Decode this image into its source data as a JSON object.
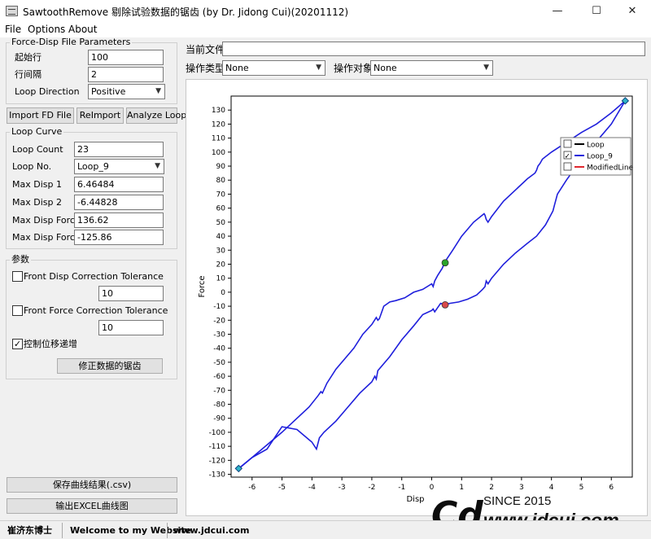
{
  "window": {
    "title": "SawtoothRemove 剔除试验数据的锯齿 (by Dr. Jidong Cui)(20201112)",
    "minimize": "—",
    "maximize": "☐",
    "close": "✕"
  },
  "menu": {
    "file": "File",
    "options": "Options",
    "about": "About"
  },
  "fd_params": {
    "title": "Force-Disp File Parameters",
    "start_row_label": "起始行",
    "start_row_value": "100",
    "row_interval_label": "行间隔",
    "row_interval_value": "2",
    "loop_direction_label": "Loop Direction",
    "loop_direction_value": "Positive"
  },
  "buttons": {
    "import": "Import FD File",
    "reimport": "ReImport",
    "analyze": "Analyze Loop",
    "correct": "修正数据的锯齿",
    "save_csv": "保存曲线结果(.csv)",
    "export_excel": "输出EXCEL曲线图"
  },
  "loop_curve": {
    "title": "Loop Curve",
    "loop_count_label": "Loop Count",
    "loop_count_value": "23",
    "loop_no_label": "Loop No.",
    "loop_no_value": "Loop_9",
    "max_disp1_label": "Max Disp 1",
    "max_disp1_value": "6.46484",
    "max_disp2_label": "Max Disp 2",
    "max_disp2_value": "-6.44828",
    "max_force1_label": "Max Disp Force 1",
    "max_force1_value": "136.62",
    "max_force2_label": "Max Disp Force 2",
    "max_force2_value": "-125.86"
  },
  "params": {
    "title": "参数",
    "front_disp_label": "Front Disp Correction Tolerance",
    "front_disp_checked": false,
    "front_disp_value": "10",
    "front_force_label": "Front Force Correction Tolerance",
    "front_force_checked": false,
    "front_force_value": "10",
    "control_disp_label": "控制位移递增",
    "control_disp_checked": true
  },
  "top": {
    "current_file_label": "当前文件",
    "current_file_value": "",
    "op_type_label": "操作类型",
    "op_type_value": "None",
    "op_target_label": "操作对象",
    "op_target_value": "None"
  },
  "statusbar": {
    "author": "崔济东博士",
    "welcome": "Welcome to my Website",
    "site": "www.jdcui.com"
  },
  "watermark": {
    "logo": "Cd",
    "since": "SINCE 2015",
    "url": "www.jdcui.com"
  },
  "colors": {
    "loop_line": "#1f1fdc",
    "loop_legend": "#000000",
    "modified_legend": "#e0282f",
    "marker_green": "#2aa52a",
    "marker_red": "#d84a4a",
    "marker_cyan": "#2fb3c8"
  },
  "chart_data": {
    "type": "line",
    "xlabel": "Disp",
    "ylabel": "Force",
    "xlim": [
      -6.7,
      6.7
    ],
    "ylim": [
      -132,
      140
    ],
    "xticks": [
      -6,
      -5,
      -4,
      -3,
      -2,
      -1,
      0,
      1,
      2,
      3,
      4,
      5,
      6
    ],
    "yticks": [
      -130,
      -120,
      -110,
      -100,
      -90,
      -80,
      -70,
      -60,
      -50,
      -40,
      -30,
      -20,
      -10,
      0,
      10,
      20,
      30,
      40,
      50,
      60,
      70,
      80,
      90,
      100,
      110,
      120,
      130
    ],
    "legend": {
      "placement": "top-right",
      "entries": [
        {
          "name": "Loop",
          "checked": false
        },
        {
          "name": "Loop_9",
          "checked": true
        },
        {
          "name": "ModifiedLine",
          "checked": false
        }
      ]
    },
    "series": [
      {
        "name": "Loop_9",
        "x": [
          -6.45,
          -6.0,
          -5.0,
          -4.1,
          -3.8,
          -3.7,
          -3.65,
          -3.5,
          -3.2,
          -2.6,
          -2.3,
          -2.0,
          -1.85,
          -1.8,
          -1.75,
          -1.7,
          -1.6,
          -1.4,
          -1.2,
          -0.9,
          -0.6,
          -0.3,
          0.0,
          0.05,
          0.1,
          0.2,
          0.35,
          0.45,
          0.7,
          1.0,
          1.4,
          1.75,
          1.78,
          1.82,
          1.88,
          2.0,
          2.4,
          2.8,
          3.2,
          3.45,
          3.5,
          3.55,
          3.62,
          3.7,
          4.0,
          4.5,
          5.0,
          5.5,
          6.0,
          6.46484
        ],
        "y": [
          -126,
          -118,
          -100,
          -82,
          -74,
          -71,
          -72,
          -65,
          -55,
          -40,
          -30,
          -23,
          -18,
          -20,
          -19,
          -16,
          -10,
          -7,
          -6,
          -4,
          0,
          2,
          6,
          4,
          8,
          12,
          17,
          22,
          30,
          40,
          50,
          56,
          55,
          52,
          50,
          54,
          65,
          73,
          81,
          85,
          87,
          90,
          92,
          95,
          100,
          107,
          114,
          120,
          128,
          136.62
        ]
      },
      {
        "name": "Loop_9 (return)",
        "x": [
          6.46484,
          6.0,
          5.0,
          4.5,
          4.2,
          4.1,
          4.05,
          4.0,
          3.8,
          3.5,
          3.2,
          2.8,
          2.4,
          2.0,
          1.88,
          1.82,
          1.78,
          1.7,
          1.5,
          1.2,
          0.9,
          0.6,
          0.45,
          0.3,
          0.1,
          0.05,
          0.0,
          -0.3,
          -0.6,
          -1.0,
          -1.4,
          -1.8,
          -1.85,
          -1.9,
          -2.0,
          -2.4,
          -2.8,
          -3.2,
          -3.6,
          -3.75,
          -3.8,
          -3.85,
          -4.0,
          -4.5,
          -5.0,
          -5.5,
          -6.0,
          -6.44828
        ],
        "y": [
          136.62,
          120,
          95,
          80,
          70,
          62,
          58,
          56,
          48,
          40,
          35,
          28,
          20,
          10,
          6,
          8,
          4,
          2,
          -2,
          -5,
          -7,
          -8,
          -9,
          -8,
          -14,
          -12,
          -13,
          -16,
          -24,
          -34,
          -46,
          -56,
          -62,
          -60,
          -64,
          -72,
          -82,
          -92,
          -100,
          -104,
          -108,
          -112,
          -107,
          -98,
          -96,
          -112,
          -118,
          -125.86
        ]
      }
    ],
    "markers": [
      {
        "name": "max",
        "x": 6.46484,
        "y": 136.62,
        "color": "cyan"
      },
      {
        "name": "min",
        "x": -6.44828,
        "y": -125.86,
        "color": "cyan"
      },
      {
        "name": "zero-up",
        "x": 0.45,
        "y": 21,
        "color": "green"
      },
      {
        "name": "zero-down",
        "x": 0.45,
        "y": -9,
        "color": "red"
      }
    ]
  }
}
